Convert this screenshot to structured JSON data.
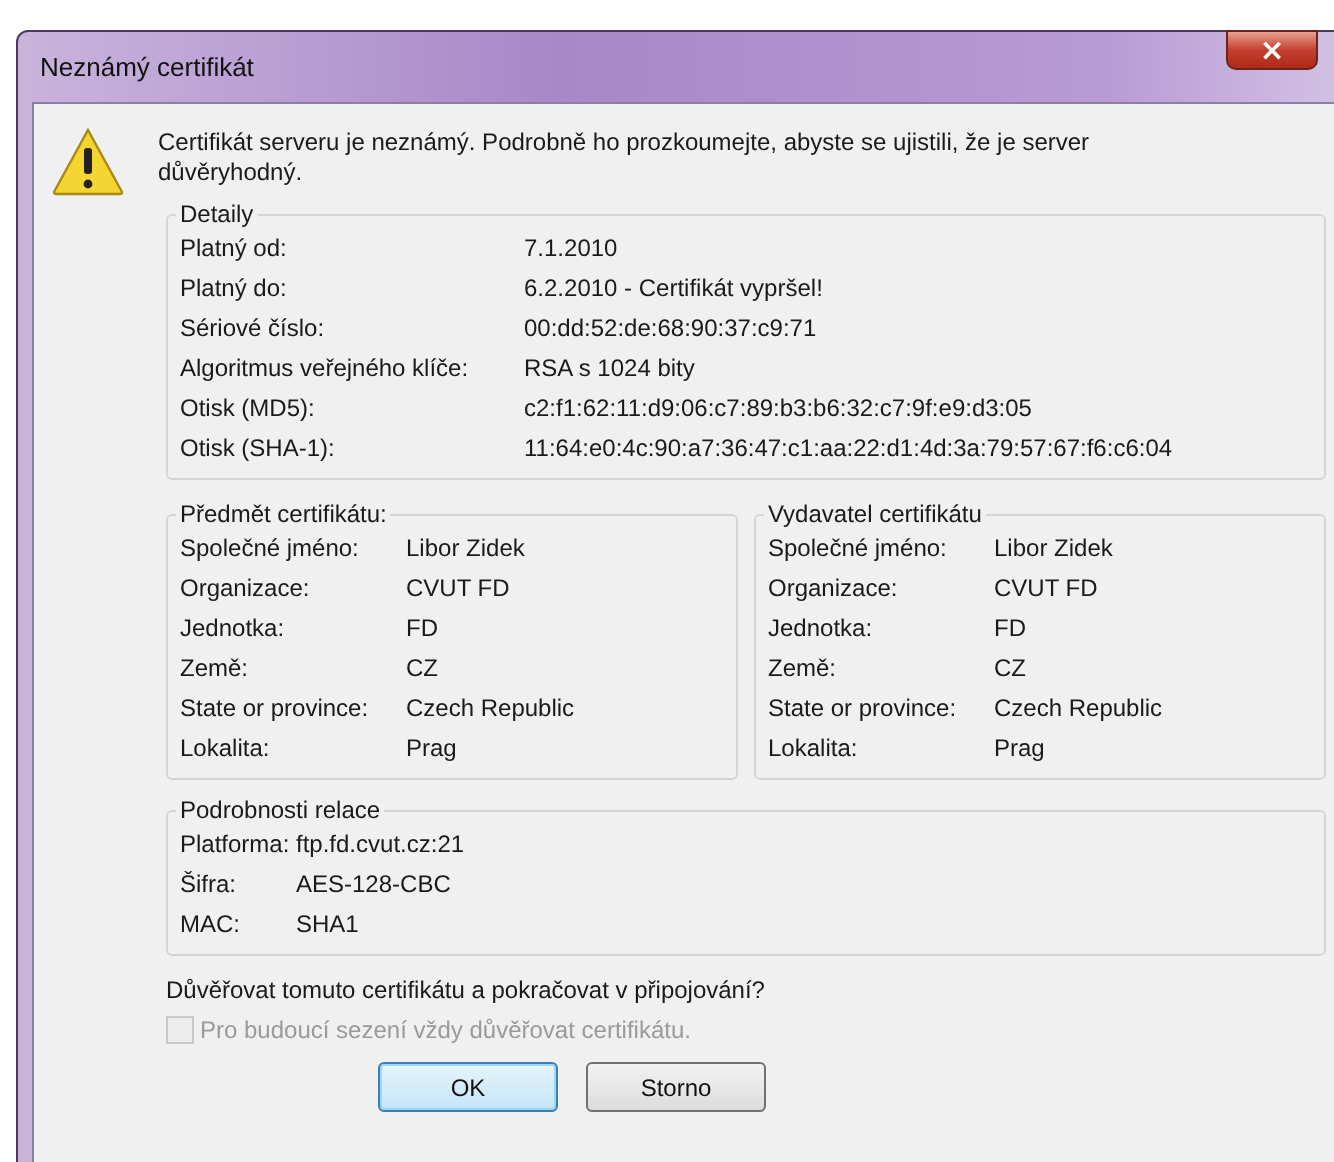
{
  "window": {
    "title": "Neznámý certifikát",
    "close": "×"
  },
  "message": "Certifikát serveru je neznámý. Podrobně ho prozkoumejte, abyste se ujistili, že je server důvěryhodný.",
  "details": {
    "title": "Detaily",
    "rows": [
      {
        "label": "Platný od:",
        "value": "7.1.2010"
      },
      {
        "label": "Platný do:",
        "value": "6.2.2010 - Certifikát vypršel!"
      },
      {
        "label": "Sériové číslo:",
        "value": "00:dd:52:de:68:90:37:c9:71"
      },
      {
        "label": "Algoritmus veřejného klíče:",
        "value": "RSA s 1024 bity"
      },
      {
        "label": "Otisk (MD5):",
        "value": "c2:f1:62:11:d9:06:c7:89:b3:b6:32:c7:9f:e9:d3:05"
      },
      {
        "label": "Otisk (SHA-1):",
        "value": "11:64:e0:4c:90:a7:36:47:c1:aa:22:d1:4d:3a:79:57:67:f6:c6:04"
      }
    ]
  },
  "parties": [
    {
      "title": "Předmět certifikátu:",
      "rows": [
        {
          "label": "Společné jméno:",
          "value": "Libor Zidek"
        },
        {
          "label": "Organizace:",
          "value": "CVUT FD"
        },
        {
          "label": "Jednotka:",
          "value": "FD"
        },
        {
          "label": "Země:",
          "value": "CZ"
        },
        {
          "label": "State or province:",
          "value": "Czech Republic"
        },
        {
          "label": "Lokalita:",
          "value": "Prag"
        }
      ]
    },
    {
      "title": "Vydavatel certifikátu",
      "rows": [
        {
          "label": "Společné jméno:",
          "value": "Libor Zidek"
        },
        {
          "label": "Organizace:",
          "value": "CVUT FD"
        },
        {
          "label": "Jednotka:",
          "value": "FD"
        },
        {
          "label": "Země:",
          "value": "CZ"
        },
        {
          "label": "State or province:",
          "value": "Czech Republic"
        },
        {
          "label": "Lokalita:",
          "value": "Prag"
        }
      ]
    }
  ],
  "session": {
    "title": "Podrobnosti relace",
    "rows": [
      {
        "label": "Platforma:",
        "value": "ftp.fd.cvut.cz:21"
      },
      {
        "label": "Šifra:",
        "value": "AES-128-CBC"
      },
      {
        "label": "MAC:",
        "value": "SHA1"
      }
    ]
  },
  "question": "Důvěřovat tomuto certifikátu a pokračovat v připojování?",
  "remember": {
    "label": "Pro budoucí sezení vždy důvěřovat certifikátu.",
    "checked": false,
    "disabled": true
  },
  "buttons": [
    {
      "label": "OK",
      "focused": true
    },
    {
      "label": "Storno",
      "focused": false
    }
  ]
}
